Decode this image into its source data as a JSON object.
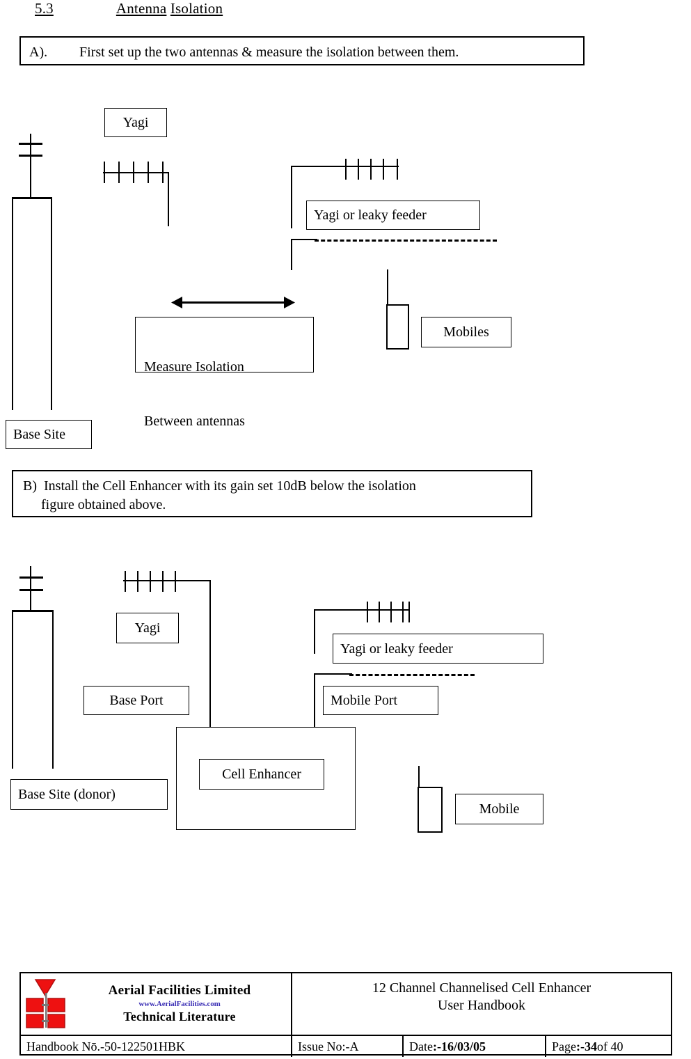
{
  "section": {
    "number": "5.3",
    "title_part1": "Antenna",
    "title_part2": "Isolation"
  },
  "steps": {
    "a_label": "A).",
    "a_text": "First set up the two antennas & measure the isolation between them.",
    "b_label": "B)",
    "b_text_line1": "Install the Cell Enhancer with its gain set 10dB below the isolation",
    "b_text_line2": "figure obtained above."
  },
  "diagram_a": {
    "yagi_label": "Yagi",
    "yagi_leaky_label": "Yagi or leaky feeder",
    "measure_line1": "Measure Isolation",
    "measure_line2": "Between antennas",
    "mobiles_label": "Mobiles",
    "base_site_label": "Base Site"
  },
  "diagram_b": {
    "yagi_label": "Yagi",
    "base_port_label": "Base Port",
    "base_site_label": "Base Site (donor)",
    "cell_enhancer_label": "Cell Enhancer",
    "yagi_leaky_label": "Yagi or leaky feeder",
    "mobile_port_label": "Mobile Port",
    "mobile_label": "Mobile"
  },
  "footer": {
    "brand_name": "Aerial  Facilities  Limited",
    "brand_url": "www.AerialFacilities.com",
    "brand_tagline": "Technical Literature",
    "doc_title": "12 Channel Channelised Cell Enhancer",
    "doc_subtitle": "User Handbook",
    "handbook_no": "Handbook Nō.-50-122501HBK",
    "issue_no": "Issue No:-A",
    "date_label": "Date",
    "date_value": ":-16/03/05",
    "page_label": "Page",
    "page_value": ":-34",
    "page_total": " of 40",
    "logo_color": "#ee1111",
    "logo_border_color": "#b01010",
    "url_color": "#3b2fb5"
  }
}
